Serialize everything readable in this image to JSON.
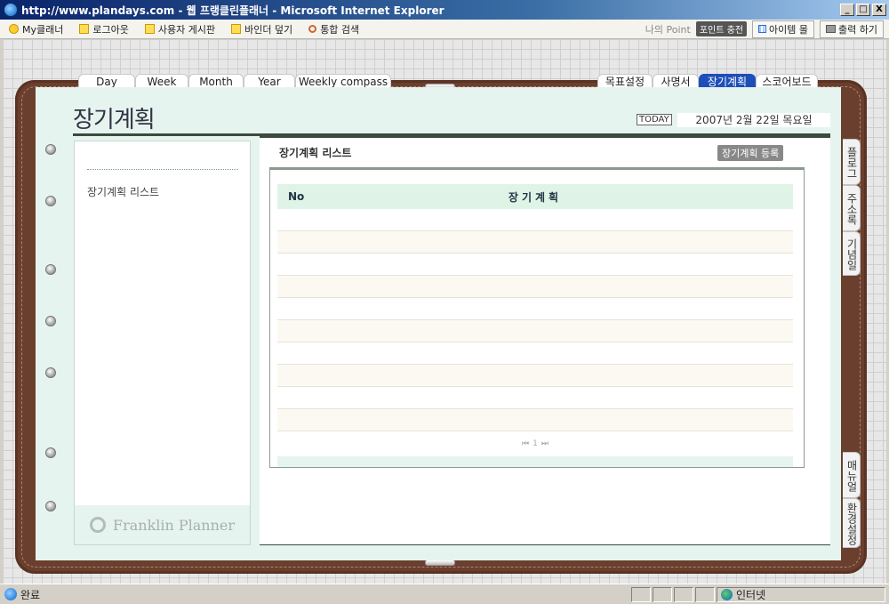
{
  "window": {
    "title": "http://www.plandays.com - 웹 프랭클린플래너 - Microsoft Internet Explorer",
    "min": "_",
    "max": "□",
    "close": "X"
  },
  "toolbar": {
    "items": [
      "My클래너",
      "로그아웃",
      "사용자 게시판",
      "바인더 덮기",
      "통합 검색"
    ],
    "point_label": "나의 Point",
    "point_button": "포인트 충전",
    "item_mall": "아이템 몰",
    "print": "출력 하기"
  },
  "tabs_left": [
    "Day",
    "Week",
    "Month",
    "Year",
    "Weekly compass"
  ],
  "tabs_right": [
    "목표설정",
    "사명서",
    "장기계획",
    "스코어보드"
  ],
  "active_tab": "장기계획",
  "side_tabs": [
    "플로그",
    "주소록",
    "기념일",
    "매뉴얼",
    "환경설정"
  ],
  "page": {
    "title": "장기계획",
    "today_label": "TODAY",
    "date": "2007년 2월 22일 목요일"
  },
  "left_panel": {
    "menu_item": "장기계획 리스트",
    "logo_text": "Franklin Planner"
  },
  "main": {
    "heading": "장기계획 리스트",
    "register_button": "장기계획 등록",
    "columns": [
      "No",
      "장기계획"
    ],
    "rows": [],
    "pager": {
      "first": "⏮",
      "page": "1",
      "last": "⏭"
    }
  },
  "statusbar": {
    "status": "완료",
    "zone": "인터넷"
  }
}
